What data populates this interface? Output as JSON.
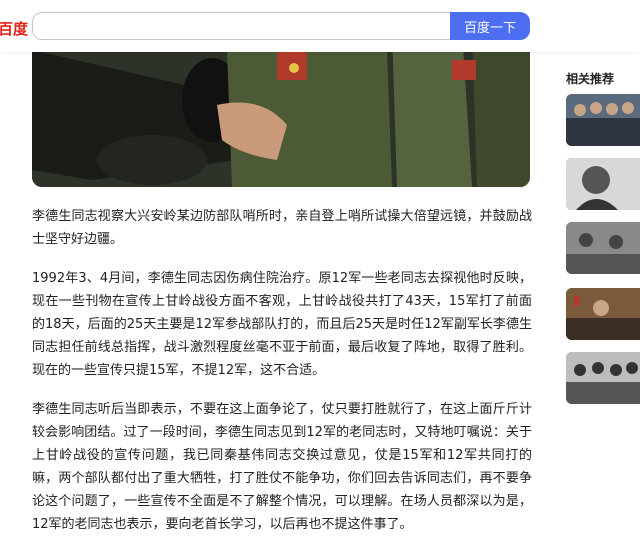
{
  "header": {
    "logo_text": "百度",
    "search_value": "",
    "search_button": "百度一下"
  },
  "article": {
    "paragraphs": [
      "李德生同志视察大兴安岭某边防部队哨所时，亲自登上哨所试操大倍望远镜，并鼓励战士坚守好边疆。",
      "1992年3、4月间，李德生同志因伤病住院治疗。原12军一些老同志去探视他时反映，现在一些刊物在宣传上甘岭战役方面不客观，上甘岭战役共打了43天，15军打了前面的18天，后面的25天主要是12军参战部队打的，而且后25天是时任12军副军长李德生同志担任前线总指挥，战斗激烈程度丝毫不亚于前面，最后收复了阵地，取得了胜利。现在的一些宣传只提15军，不提12军，这不合适。",
      "李德生同志听后当即表示，不要在这上面争论了，仗只要打胜就行了，在这上面斤斤计较会影响团结。过了一段时间，李德生同志见到12军的老同志时，又特地叮嘱说：关于上甘岭战役的宣传问题，我已同秦基伟同志交换过意见，仗是15军和12军共同打的嘛，两个部队都付出了重大牺牲，打了胜仗不能争功，你们回去告诉同志们，再不要争论这个问题了，一些宣传不全面是不了解整个情况，可以理解。在场人员都深以为是，12军的老同志也表示，要向老首长学习，以后再也不提这件事了。"
    ]
  },
  "sidebar": {
    "title": "相关推荐"
  },
  "colors": {
    "brand": "#4e6ef2",
    "logo": "#e1251b"
  }
}
